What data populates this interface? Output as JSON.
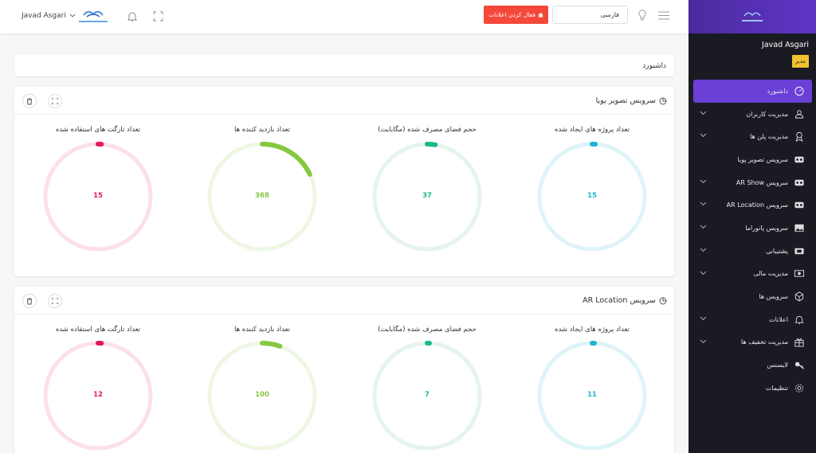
{
  "header": {
    "user_name": "Javad Asgari",
    "notif_button": "فعال کردن اعلانات",
    "language_value": "فارسی"
  },
  "sidebar": {
    "user_name": "Javad Asgari",
    "role": "مدیر",
    "items": [
      {
        "label": "داشبورد",
        "icon": "dashboard-icon",
        "active": true,
        "has_chevron": false
      },
      {
        "label": "مدیریت کاربران",
        "icon": "users-icon",
        "has_chevron": true
      },
      {
        "label": "مدیریت پلن ها",
        "icon": "award-icon",
        "has_chevron": true
      },
      {
        "label": "سرویس تصویر پویا",
        "icon": "vr-icon",
        "has_chevron": false
      },
      {
        "label": "AR Show سرویس",
        "icon": "vr-icon",
        "has_chevron": true
      },
      {
        "label": "AR Location سرویس",
        "icon": "vr-icon",
        "has_chevron": true
      },
      {
        "label": "سرویس پانوراما",
        "icon": "image-icon",
        "has_chevron": true
      },
      {
        "label": "پشتیبانی",
        "icon": "ticket-icon",
        "has_chevron": true
      },
      {
        "label": "مدیریت مالی",
        "icon": "money-icon",
        "has_chevron": true
      },
      {
        "label": "سرویس ها",
        "icon": "cube-icon",
        "has_chevron": false
      },
      {
        "label": "اعلانات",
        "icon": "bell-icon",
        "has_chevron": true
      },
      {
        "label": "مدیریت تخفیف ها",
        "icon": "gift-icon",
        "has_chevron": true
      },
      {
        "label": "لایسنس",
        "icon": "key-icon",
        "has_chevron": false
      },
      {
        "label": "تنظیمات",
        "icon": "gear-icon",
        "has_chevron": false
      }
    ]
  },
  "breadcrumb": "داشبورد",
  "cards": [
    {
      "title": "سرویس تصویر پویا",
      "metrics": [
        {
          "label": "تعداد پروژه های ایجاد شده",
          "value": "15",
          "fraction": 0.02,
          "color": "#1fb6d0",
          "track": "#dff4f9"
        },
        {
          "label": "حجم فضای مصرف شده (مگابایت)",
          "value": "37",
          "fraction": 0.05,
          "color": "#17b990",
          "track": "#e5f4ec"
        },
        {
          "label": "تعداد بازدید کننده ها",
          "value": "368",
          "fraction": 0.36,
          "color": "#86c83f",
          "track": "#eef7e4"
        },
        {
          "label": "تعداد تارگت های استفاده شده",
          "value": "15",
          "fraction": 0.02,
          "color": "#e3185f",
          "track": "#fce0e8"
        }
      ]
    },
    {
      "title": "AR Location سرویس",
      "metrics": [
        {
          "label": "تعداد پروژه های ایجاد شده",
          "value": "11",
          "fraction": 0.015,
          "color": "#1fb6d0",
          "track": "#dff4f9"
        },
        {
          "label": "حجم فضای مصرف شده (مگابایت)",
          "value": "7",
          "fraction": 0.01,
          "color": "#17b990",
          "track": "#e5f4ec"
        },
        {
          "label": "تعداد بازدید کننده ها",
          "value": "100",
          "fraction": 0.11,
          "color": "#86c83f",
          "track": "#eef7e4"
        },
        {
          "label": "تعداد تارگت های استفاده شده",
          "value": "12",
          "fraction": 0.02,
          "color": "#e3185f",
          "track": "#fce0e8"
        }
      ]
    }
  ]
}
